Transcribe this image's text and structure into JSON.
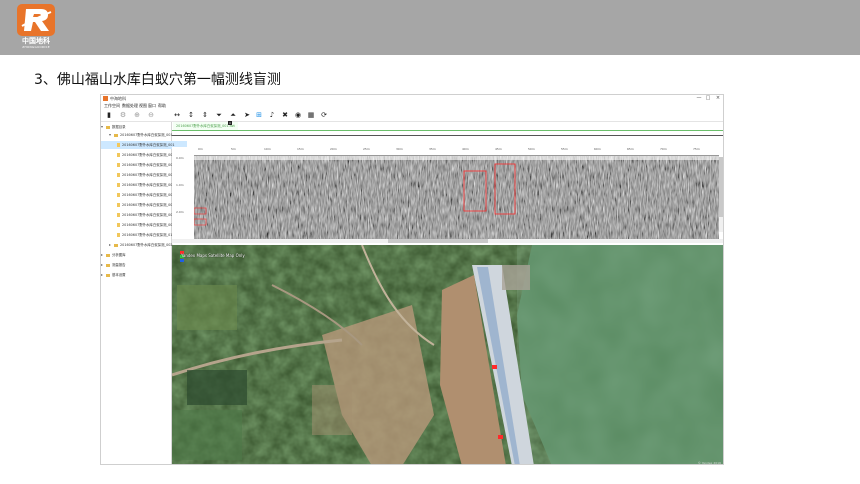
{
  "logo": {
    "text": "中国地科",
    "subtext": "ZHONGGUODIKE"
  },
  "slide": {
    "title": "3、佛山福山水库白蚁穴第一幅测线盲测"
  },
  "app": {
    "title": "中海地科",
    "window_controls": [
      "—",
      "□",
      "×"
    ],
    "menu": [
      "工作空间",
      "数据处理",
      "视图",
      "窗口",
      "帮助"
    ],
    "toolbar_icons": [
      "new-file-icon",
      "settings-icon",
      "zoom-in-icon",
      "zoom-out-icon",
      "pan-horizontal-icon",
      "pan-vertical-icon",
      "stretch-icon",
      "triangle-up-icon",
      "triangle-down-icon",
      "select-icon",
      "crosshair-icon",
      "music-icon",
      "trash-icon",
      "view-icon",
      "grid-icon",
      "split-icon"
    ],
    "tree": {
      "root": "数据目录",
      "project": "20160607野外水库白蚁探测_001",
      "files": [
        "20160607野外水库白蚁探测_001",
        "20160607野外水库白蚁探测_002",
        "20160607野外水库白蚁探测_003",
        "20160607野外水库白蚁探测_004",
        "20160607野外水库白蚁探测_005",
        "20160607野外水库白蚁探测_006",
        "20160607野外水库白蚁探测_007",
        "20160607野外水库白蚁探测_008",
        "20160607野外水库白蚁探测_009",
        "20160607野外水库白蚁探测_010"
      ],
      "project2": "20160607野外水库白蚁探测_002",
      "extra": [
        "分析图库",
        "测量报告",
        "基本设置"
      ]
    },
    "tab_label": "20160607野外水库白蚁探测_001.dzt",
    "tab_close": "×",
    "ruler_ticks": [
      "0m",
      "5m",
      "10m",
      "15m",
      "20m",
      "25m",
      "30m",
      "35m",
      "40m",
      "45m",
      "50m",
      "55m",
      "60m",
      "65m",
      "70m",
      "75m"
    ],
    "depth_left": [
      "0.0m",
      "1.0m",
      "2.0m"
    ],
    "depth_right": [
      "0ns",
      "10ns",
      "20ns"
    ],
    "map_caption": "Yandex Maps Satellite Map Only",
    "map_copyright": "© Yandex 2016"
  },
  "colors": {
    "topbar": "#a6a6a6",
    "accent": "#e8742a",
    "selection": "#cde8ff",
    "tab_green": "#4a9f4a",
    "marker_red": "#ff2a2a"
  }
}
